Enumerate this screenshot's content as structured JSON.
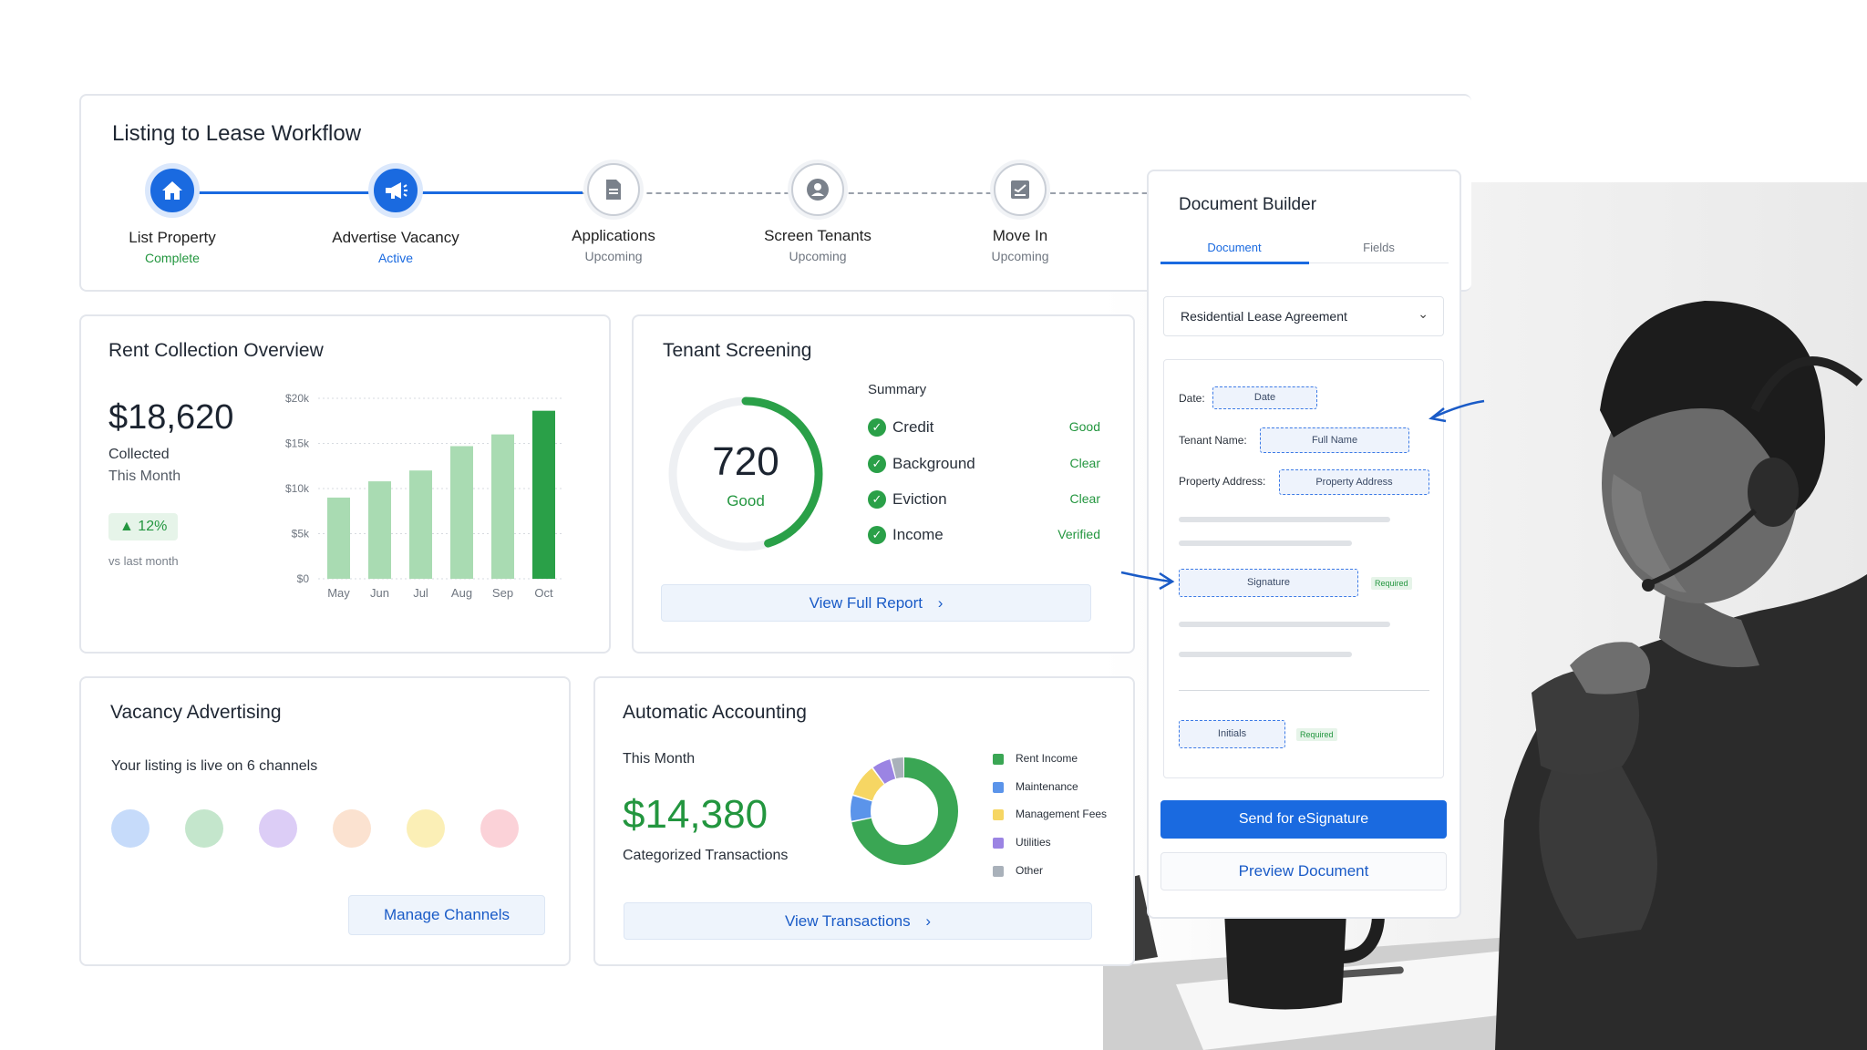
{
  "workflow": {
    "title": "Listing to Lease Workflow",
    "steps": [
      {
        "label": "List Property",
        "status": "Complete",
        "icon": "home-icon"
      },
      {
        "label": "Advertise Vacancy",
        "status": "Active",
        "icon": "megaphone-icon"
      },
      {
        "label": "Applications",
        "status": "Upcoming",
        "icon": "document-icon"
      },
      {
        "label": "Screen Tenants",
        "status": "Upcoming",
        "icon": "person-icon"
      },
      {
        "label": "Move In",
        "status": "Upcoming",
        "icon": "sign-icon"
      }
    ]
  },
  "rent": {
    "title": "Rent Collection Overview",
    "amount": "$18,620",
    "label1": "Collected",
    "label2": "This Month",
    "change": "12%",
    "change_note": "vs last month"
  },
  "chart_data": {
    "type": "bar",
    "categories": [
      "May",
      "Jun",
      "Jul",
      "Aug",
      "Sep",
      "Oct"
    ],
    "values": [
      9000,
      10800,
      12000,
      14700,
      16000,
      18620
    ],
    "ylim": [
      0,
      20000
    ],
    "yticks": [
      "$0",
      "$5k",
      "$10k",
      "$15k",
      "$20k"
    ],
    "ytick_values": [
      0,
      5000,
      10000,
      15000,
      20000
    ],
    "colors": {
      "bar": "#a9dbb2",
      "highlight": "#2aa048"
    }
  },
  "screening": {
    "title": "Tenant Screening",
    "score": "720",
    "score_label": "Good",
    "score_fraction": 0.45,
    "summary_title": "Summary",
    "rows": [
      {
        "label": "Credit",
        "value": "Good"
      },
      {
        "label": "Background",
        "value": "Clear"
      },
      {
        "label": "Eviction",
        "value": "Clear"
      },
      {
        "label": "Income",
        "value": "Verified"
      }
    ],
    "button": "View Full Report"
  },
  "vacancy": {
    "title": "Vacancy Advertising",
    "subtitle": "Your listing is live on 6 channels",
    "channel_colors": [
      "#c6dbfa",
      "#c4e6cc",
      "#dccdf6",
      "#fbe2d0",
      "#fbefb6",
      "#fbd2d8"
    ],
    "button": "Manage Channels"
  },
  "accounting": {
    "title": "Automatic Accounting",
    "period": "This Month",
    "amount": "$14,380",
    "caption": "Categorized Transactions",
    "legend": [
      {
        "label": "Rent Income",
        "color": "#3aa654"
      },
      {
        "label": "Maintenance",
        "color": "#5b94ea"
      },
      {
        "label": "Management Fees",
        "color": "#f6d663"
      },
      {
        "label": "Utilities",
        "color": "#9b84e3"
      },
      {
        "label": "Other",
        "color": "#a9b1ba"
      }
    ],
    "donut_shares": [
      0.72,
      0.08,
      0.1,
      0.06,
      0.04
    ],
    "button": "View Transactions"
  },
  "docbuilder": {
    "title": "Document Builder",
    "tabs": [
      "Document",
      "Fields"
    ],
    "template": "Residential Lease Agreement",
    "fields": {
      "date_label": "Date:",
      "date_field": "Date",
      "tenant_label": "Tenant Name:",
      "tenant_field": "Full Name",
      "address_label": "Property Address:",
      "address_field": "Property Address",
      "signature_field": "Signature",
      "initials_field": "Initials",
      "required": "Required"
    },
    "primary_button": "Send for eSignature",
    "secondary_button": "Preview Document"
  },
  "colors": {
    "accent": "#1a6ae0",
    "success": "#23963f"
  }
}
